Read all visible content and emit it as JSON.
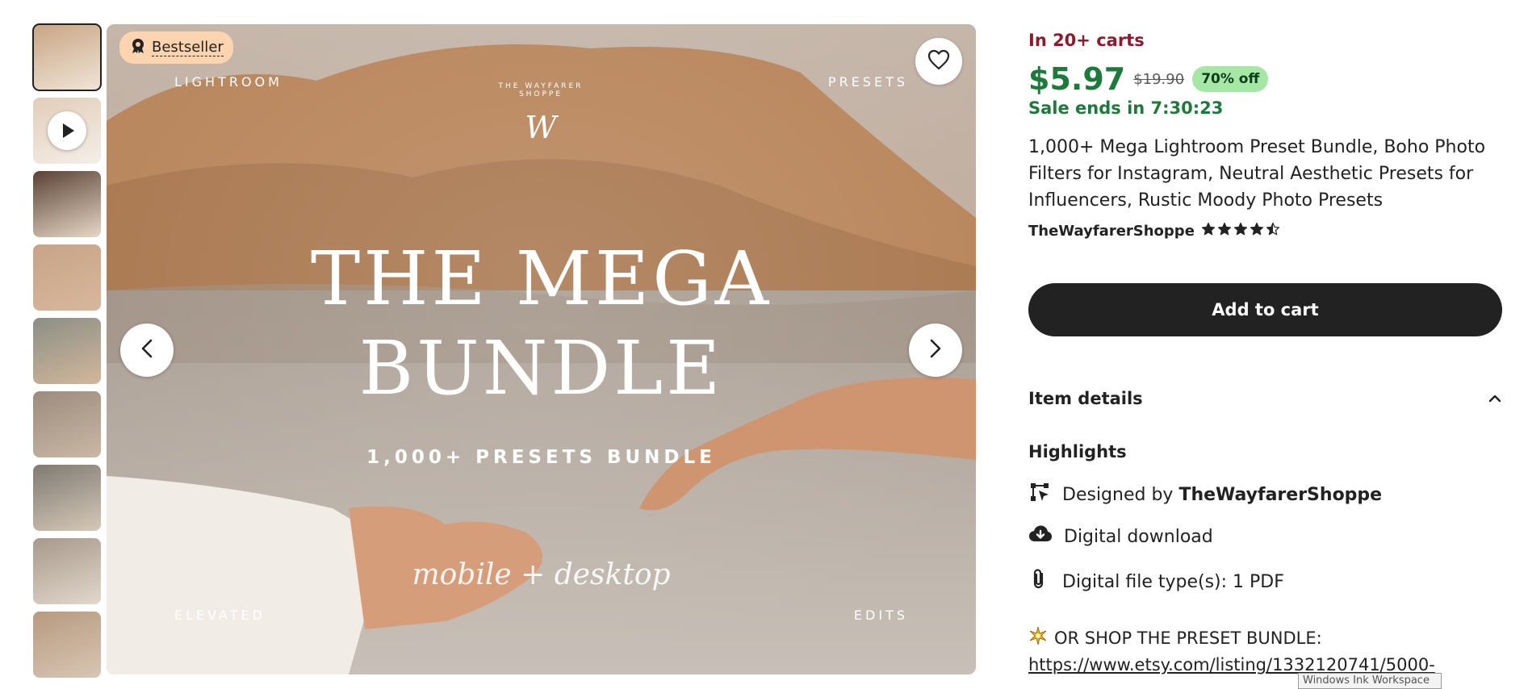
{
  "thumbnails": [
    {
      "name": "thumb-1",
      "active": true,
      "video": false,
      "colors": [
        "#c9a582",
        "#f0e5d8"
      ]
    },
    {
      "name": "thumb-2",
      "active": false,
      "video": true,
      "colors": [
        "#e2cdb8",
        "#f4efe8"
      ]
    },
    {
      "name": "thumb-3",
      "active": false,
      "video": false,
      "colors": [
        "#5a4235",
        "#e6d7c5"
      ]
    },
    {
      "name": "thumb-4",
      "active": false,
      "video": false,
      "colors": [
        "#c8a487",
        "#d7b79c"
      ]
    },
    {
      "name": "thumb-5",
      "active": false,
      "video": false,
      "colors": [
        "#8b8f86",
        "#d2b79b"
      ]
    },
    {
      "name": "thumb-6",
      "active": false,
      "video": false,
      "colors": [
        "#9d8c7d",
        "#c9b8a5"
      ]
    },
    {
      "name": "thumb-7",
      "active": false,
      "video": false,
      "colors": [
        "#7f7a72",
        "#d5c8b8"
      ]
    },
    {
      "name": "thumb-8",
      "active": false,
      "video": false,
      "colors": [
        "#a7998b",
        "#e2d8cc"
      ]
    },
    {
      "name": "thumb-9",
      "active": false,
      "video": false,
      "colors": [
        "#b79a80",
        "#d8c6b3"
      ]
    }
  ],
  "main_image": {
    "badge": "Bestseller",
    "corner_top_left": "LIGHTROOM",
    "corner_top_right": "PRESETS",
    "corner_bottom_left": "ELEVATED",
    "corner_bottom_right": "EDITS",
    "logo_ring": "THE WAYFARER SHOPPE",
    "logo_letter": "W",
    "headline_1": "THE MEGA",
    "headline_2": "BUNDLE",
    "subline": "1,000+ PRESETS BUNDLE",
    "script": "mobile + desktop"
  },
  "listing": {
    "carts": "In 20+ carts",
    "price": "$5.97",
    "original_price": "$19.90",
    "discount": "70% off",
    "sale_ends": "Sale ends in 7:30:23",
    "title": "1,000+ Mega Lightroom Preset Bundle, Boho Photo Filters for Instagram, Neutral Aesthetic Presets for Influencers, Rustic Moody Photo Presets",
    "shop": "TheWayfarerShoppe",
    "rating": 4.5,
    "add_to_cart": "Add to cart",
    "item_details": "Item details",
    "highlights_title": "Highlights",
    "designed_by_prefix": "Designed by",
    "designed_by_shop": "TheWayfarerShoppe",
    "digital_download": "Digital download",
    "file_types": "Digital file type(s): 1 PDF",
    "shop_bundle": "OR SHOP THE PRESET BUNDLE:",
    "bundle_link": "https://www.etsy.com/listing/1332120741/5000-"
  },
  "system": {
    "ink_workspace": "Windows Ink Workspace"
  },
  "colors": {
    "price_green": "#1d7a3a",
    "carts_red": "#8d1b2d",
    "badge_peach": "#fcd4b0",
    "discount_green": "#a6e7a6",
    "button_dark": "#222222"
  }
}
